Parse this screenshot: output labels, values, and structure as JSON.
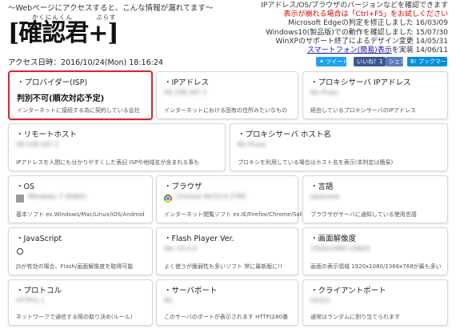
{
  "header": {
    "tagline": "〜Webページにアクセスすると、こんな情報が漏れてます〜",
    "logo_ruby_main": "かくにんくん",
    "logo_ruby_plus": "ぷらす",
    "logo": "[確認君+]",
    "access_datetime": "アクセス日時：2016/10/24(Mon) 18:16:24"
  },
  "top_right": {
    "line1": "IPアドレス/OS/ブラウザのバージョンなどを確認できます",
    "line2": "表示が崩れる場合は「Ctrl+F5」をお試しください",
    "line3": "Microsoft Edgeの判定を修正しました 16/03/09",
    "line4": "Windows10(製品版)での動作を確認しました 15/07/30",
    "line5": "WinXPのサポート終了によるデザイン変更 14/05/31",
    "line6_link": "スマートフォン(簡易)表示",
    "line6_rest": "を実装 14/06/11"
  },
  "social": {
    "tweet": "ツイート",
    "like": "いいね！1",
    "share": "シェア",
    "hatena": "ブックマーク"
  },
  "cards": {
    "isp": {
      "title": "・プロバイダー(ISP)",
      "value": "判別不可(順次対応予定)",
      "desc": "インターネットに接続する為に契約している会社"
    },
    "ip": {
      "title": "・IPアドレス",
      "value": "58.158.167.2",
      "desc": "インターネットにおける固有の住所みたいなもの"
    },
    "proxy_ip": {
      "title": "・プロキシサーバ IPアドレス",
      "value": "No Proxy",
      "desc": "経由しているプロキシサーバのIPアドレス"
    },
    "remote_host": {
      "title": "・リモートホスト",
      "value": "58.158.167.2",
      "desc": "IPアドレスを人間にも分かりやすくした表記 ISPや地域名が含まれる事も"
    },
    "proxy_host": {
      "title": "・プロキシサーバ ホスト名",
      "value": "No Proxy",
      "desc": "プロキシを利用している場合はホスト名を表示(本判定は簡易)"
    },
    "os": {
      "title": "・OS",
      "value": "Windows 7 (64bit)",
      "desc": "基本ソフト ex.Windows/Mac/Linux/iOS/Android"
    },
    "browser": {
      "title": "・ブラウザ",
      "value": "Chrome Ver53.0.2785",
      "desc": "インターネット閲覧ソフト ex.IE/Firefox/Chrome/Safari"
    },
    "language": {
      "title": "・言語",
      "value": "Japanese",
      "desc": "ブラウザがサーバに通知している使用言語"
    },
    "javascript": {
      "title": "・JavaScript",
      "value": "",
      "desc": "JSが有効の場合、Flash/画面解像度を取得可能"
    },
    "flash": {
      "title": "・Flash Player Ver.",
      "value": "Ver 23.0.0",
      "desc": "よく使うが脆弱性も多いソフト 常に最新版に!!"
    },
    "resolution": {
      "title": "・画面解像度",
      "value": "1920x1080 (24bit)",
      "desc": "画面の表示領域 1920x1080/1366x768が最も多い"
    },
    "protocol": {
      "title": "・プロトコル",
      "value": "HTTP/1.1",
      "desc": "ネットワークで通信する際の取り決め(ルール)"
    },
    "server_port": {
      "title": "・サーバポート",
      "value": "80",
      "desc": "このサーバのポートが表示されます HTTPは80番"
    },
    "client_port": {
      "title": "・クライアントポート",
      "value": "54321",
      "desc": "通常はランダムに割り当てられます"
    }
  }
}
